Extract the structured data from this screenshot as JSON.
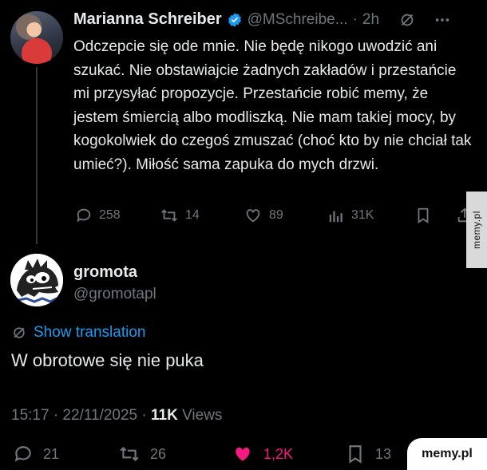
{
  "tweet": {
    "author_name": "Marianna Schreiber",
    "handle": "@MSchreibe...",
    "separator": "·",
    "time": "2h",
    "text": "Odczepcie się ode mnie. Nie będę nikogo uwodzić ani szukać. Nie obstawiajcie żadnych zakładów i przestańcie mi przysyłać propozycje. Przestańcie robić memy, że jestem śmiercią albo modliszką. Nie mam takiej mocy, by kogokolwiek do czegoś zmuszać (choć kto by nie chciał tak umieć?). Miłość sama zapuka do mych drzwi.",
    "actions": {
      "replies": "258",
      "reposts": "14",
      "likes": "89",
      "views": "31K"
    }
  },
  "reply": {
    "author_name": "gromota",
    "handle": "@gromotapl",
    "show_translation": "Show translation",
    "text": "W obrotowe się nie puka",
    "meta": {
      "time": "15:17 · 22/11/2025 · ",
      "views_count": "11K",
      "views_label": " Views"
    },
    "actions": {
      "replies": "21",
      "reposts": "26",
      "likes": "1,2K",
      "bookmarks": "13"
    }
  },
  "watermark": {
    "side": "memy.pl",
    "badge": "memy.pl"
  },
  "colors": {
    "background": "#000000",
    "text": "#e7e9ea",
    "muted": "#71767b",
    "link": "#1d9bf0",
    "like": "#f91880",
    "verified": "#1d9bf0"
  }
}
